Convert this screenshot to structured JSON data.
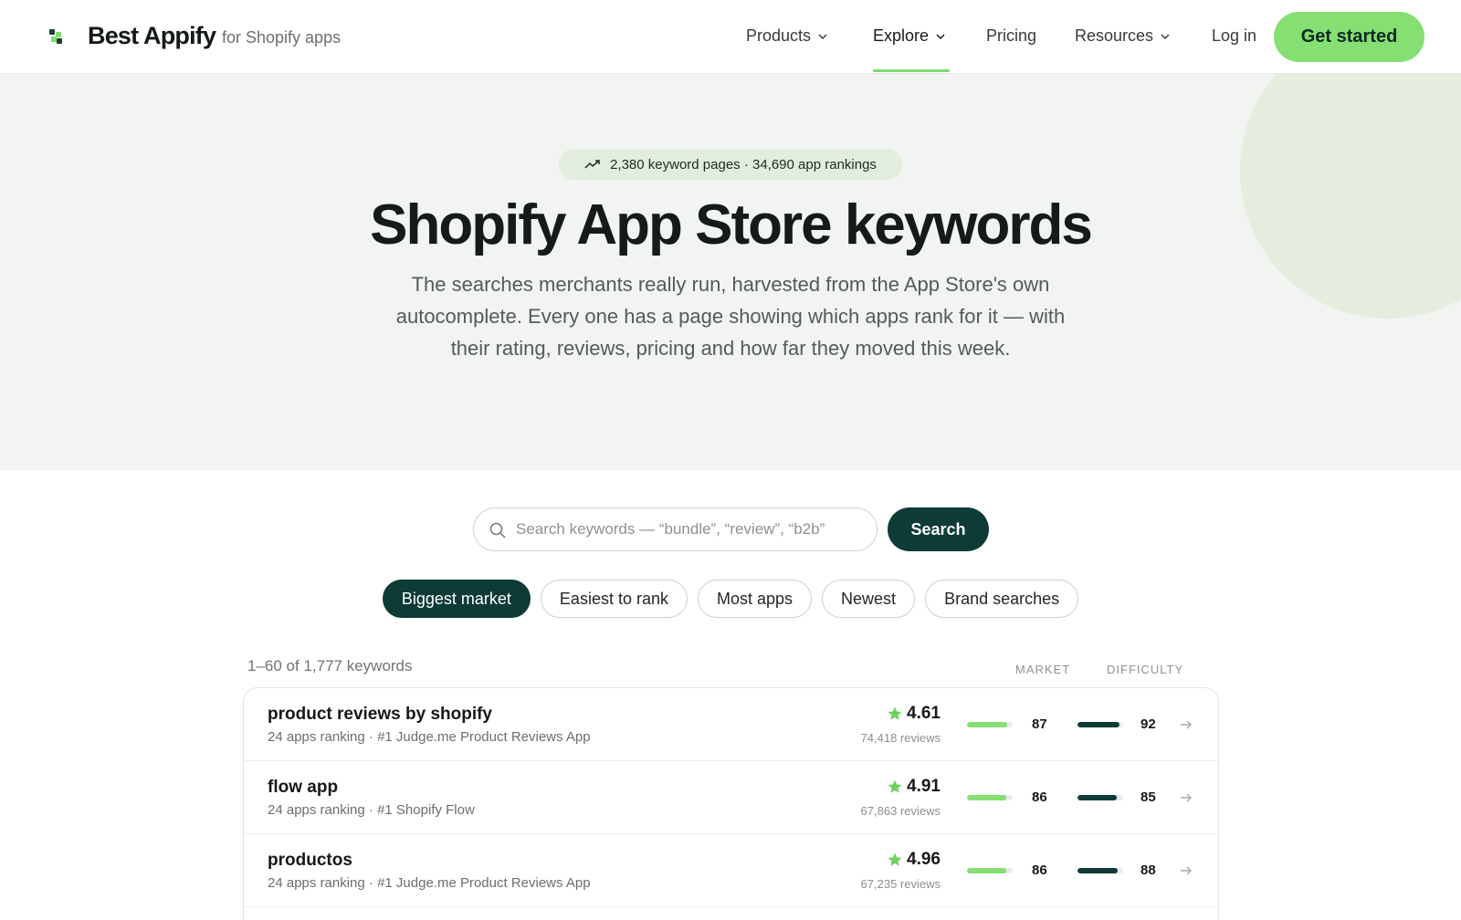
{
  "header": {
    "brand": "Best Appify",
    "brand_sub": "for Shopify apps",
    "nav": [
      {
        "label": "Products",
        "has_dropdown": true
      },
      {
        "label": "Explore",
        "has_dropdown": true,
        "active": true
      },
      {
        "label": "Pricing",
        "has_dropdown": false
      },
      {
        "label": "Resources",
        "has_dropdown": true
      }
    ],
    "login": "Log in",
    "cta": "Get started"
  },
  "hero": {
    "stats": "2,380 keyword pages · 34,690 app rankings",
    "title": "Shopify App Store keywords",
    "description": "The searches merchants really run, harvested from the App Store's own autocomplete. Every one has a page showing which apps rank for it — with their rating, reviews, pricing and how far they moved this week."
  },
  "search": {
    "placeholder": "Search keywords — “bundle”, “review”, “b2b”",
    "value": "",
    "button": "Search"
  },
  "tabs": [
    {
      "label": "Biggest market",
      "active": true
    },
    {
      "label": "Easiest to rank",
      "active": false
    },
    {
      "label": "Most apps",
      "active": false
    },
    {
      "label": "Newest",
      "active": false
    },
    {
      "label": "Brand searches",
      "active": false
    }
  ],
  "list": {
    "count_text": "1–60 of 1,777 keywords",
    "col_market": "MARKET",
    "col_difficulty": "DIFFICULTY",
    "rows": [
      {
        "keyword": "product reviews by shopify",
        "meta": "24 apps ranking · #1 Judge.me Product Reviews App",
        "rating": "4.61",
        "reviews": "74,418 reviews",
        "market": 87,
        "difficulty": 92
      },
      {
        "keyword": "flow app",
        "meta": "24 apps ranking · #1 Shopify Flow",
        "rating": "4.91",
        "reviews": "67,863 reviews",
        "market": 86,
        "difficulty": 85
      },
      {
        "keyword": "productos",
        "meta": "24 apps ranking · #1 Judge.me Product Reviews App",
        "rating": "4.96",
        "reviews": "67,235 reviews",
        "market": 86,
        "difficulty": 88
      }
    ]
  },
  "colors": {
    "accent_green": "#85df72",
    "dark_teal": "#0e3b36",
    "hero_bg": "#f2f4f1",
    "star": "#6fd15e"
  },
  "icons": [
    "logo-icon",
    "chevron-down-icon",
    "trending-up-icon",
    "search-icon",
    "star-icon",
    "arrow-right-icon"
  ]
}
